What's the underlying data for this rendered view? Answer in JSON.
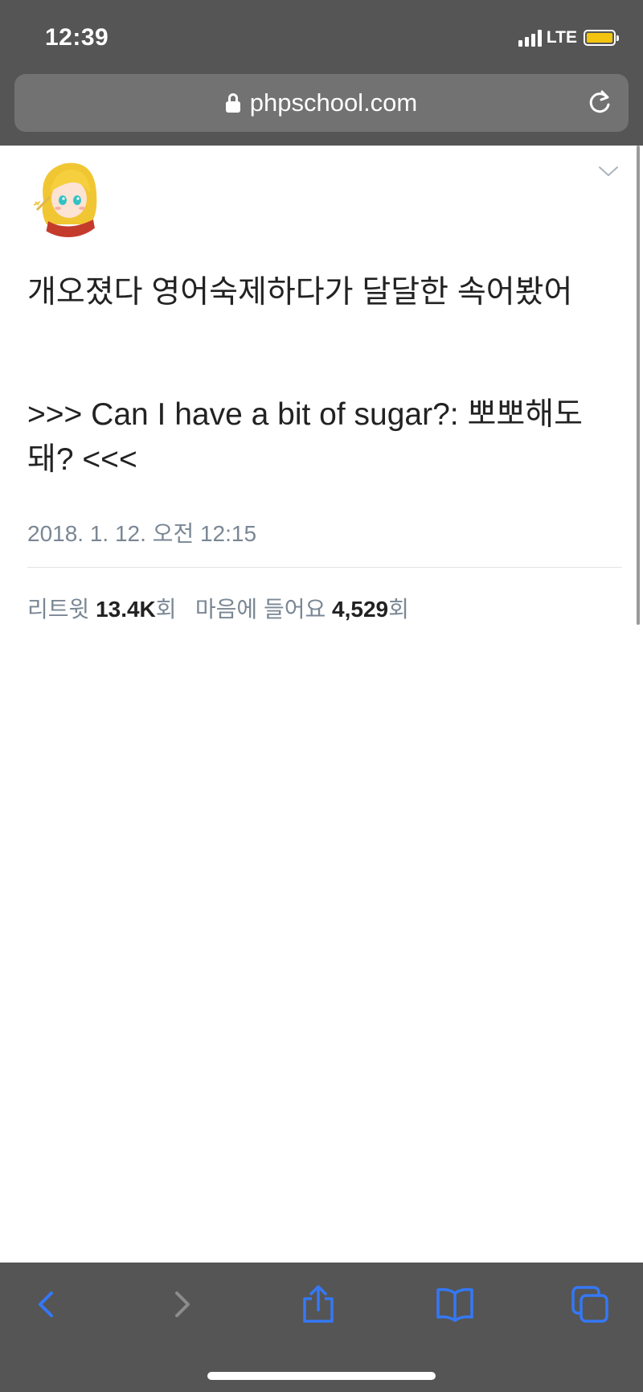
{
  "status_bar": {
    "time": "12:39",
    "network": "LTE"
  },
  "browser": {
    "url": "phpschool.com",
    "icons": {
      "lock": "lock-icon",
      "reload": "reload-icon",
      "back": "back-chevron-icon",
      "forward": "forward-chevron-icon",
      "share": "share-icon",
      "bookmarks": "bookmarks-icon",
      "tabs": "tabs-icon"
    },
    "accent_color": "#3478f6"
  },
  "tweet": {
    "line1": "개오졌다 영어숙제하다가 달달한 속어봤어",
    "line2": ">>> Can I have a bit of sugar?: 뽀뽀해도 돼? <<<",
    "date": "2018. 1. 12. 오전 12:15",
    "stats": {
      "retweet_label": "리트윗",
      "retweet_count": "13.4K",
      "retweet_suffix": "회",
      "likes_label": "마음에 들어요",
      "likes_count": "4,529",
      "likes_suffix": "회"
    }
  }
}
